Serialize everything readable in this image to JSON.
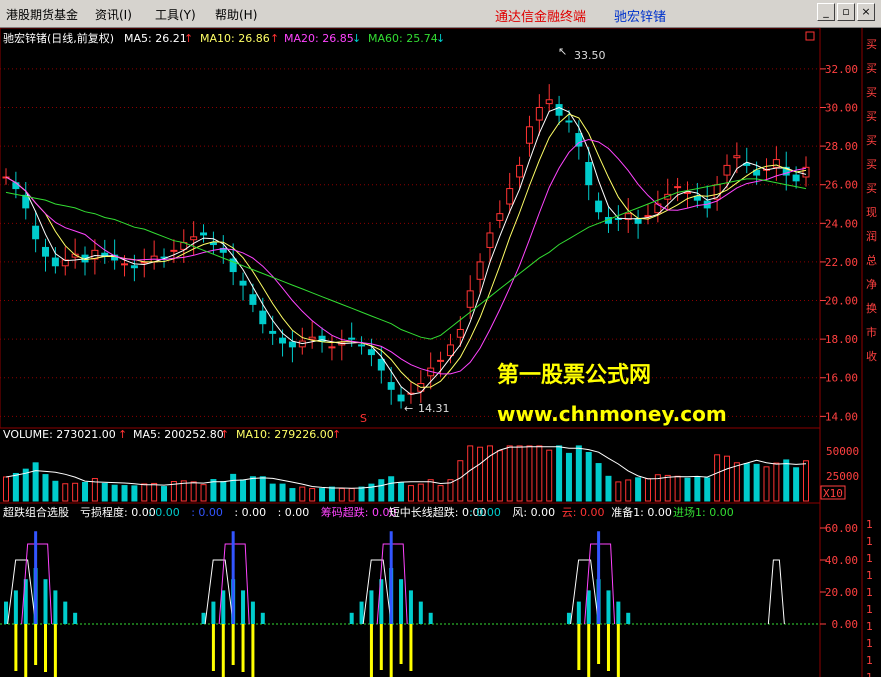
{
  "menubar": {
    "items": [
      "港股期货基金",
      "资讯(I)",
      "工具(Y)",
      "帮助(H)"
    ],
    "brand": "通达信金融终端",
    "stock_name": "驰宏锌锗",
    "window_buttons": [
      "minimize-icon",
      "restore-icon",
      "close-icon"
    ]
  },
  "colors": {
    "background": "#000000",
    "up": "#ff3333",
    "down": "#00cccc",
    "ma5": "#ffffff",
    "ma10": "#ffff66",
    "ma20": "#ff44ff",
    "ma60": "#33dd33",
    "grid": "#8b0000",
    "axis_text": "#ff4040",
    "watermark": "#ffff00"
  },
  "price_panel": {
    "title": "驰宏锌锗(日线,前复权)",
    "ma": [
      {
        "label": "MA5: 26.21",
        "arrow": "↑"
      },
      {
        "label": "MA10: 26.86",
        "arrow": "↑"
      },
      {
        "label": "MA20: 26.85",
        "arrow": "↓"
      },
      {
        "label": "MA60: 25.74",
        "arrow": "↓"
      }
    ],
    "y_ticks": [
      "32.00",
      "30.00",
      "28.00",
      "26.00",
      "24.00",
      "22.00",
      "20.00",
      "18.00",
      "16.00",
      "14.00"
    ],
    "high_marker": "33.50",
    "low_marker": "14.31",
    "s_marker": "S",
    "watermark_name": "第一股票公式网",
    "watermark_url": "www.chnmoney.com",
    "side_text": [
      "买",
      "买",
      "买",
      "买",
      "买",
      "买",
      "买",
      "现",
      "润",
      "总",
      "净",
      "换",
      "市",
      "收"
    ]
  },
  "volume_panel": {
    "label": "VOLUME: 273021.00",
    "arrow": "↑",
    "ma": [
      {
        "label": "MA5: 200252.80",
        "arrow": "↑"
      },
      {
        "label": "MA10: 279226.00",
        "arrow": "↑"
      }
    ],
    "y_ticks": [
      "50000",
      "25000"
    ],
    "unit": "X10",
    "side_text": [
      "1",
      "1",
      "1",
      "1"
    ]
  },
  "indicator_panel": {
    "name": "超跌组合选股",
    "items": [
      {
        "label": "亏损程度: 0.00",
        "color": "#ffffff"
      },
      {
        "label": ": 0.00",
        "color": "#00cccc"
      },
      {
        "label": ": 0.00",
        "color": "#3355ff"
      },
      {
        "label": ": 0.00",
        "color": "#ffffff"
      },
      {
        "label": ": 0.00",
        "color": "#ffffff"
      },
      {
        "label": "筹码超跌: 0.00",
        "color": "#ff44ff"
      },
      {
        "label": "短中长线超跌: 0.00",
        "color": "#ffffff"
      },
      {
        "label": ": 0.00",
        "color": "#00cccc"
      },
      {
        "label": "风: 0.00",
        "color": "#ffffff"
      },
      {
        "label": "云: 0.00",
        "color": "#ff3333"
      },
      {
        "label": "准备1: 0.00",
        "color": "#ffffff"
      },
      {
        "label": "进场1: 0.00",
        "color": "#33dd33"
      }
    ],
    "y_ticks": [
      "60.00",
      "40.00",
      "20.00",
      "0.00"
    ],
    "side_text": [
      "1",
      "1",
      "1",
      "1",
      "1",
      "1",
      "1",
      "1",
      "1",
      "1"
    ]
  },
  "chart_data": {
    "type": "candlestick",
    "y_range": [
      13.5,
      33.6
    ],
    "close": [
      26.4,
      25.8,
      24.8,
      23.2,
      22.3,
      21.8,
      22.1,
      22.4,
      22.0,
      22.6,
      22.3,
      22.1,
      21.9,
      21.7,
      22.0,
      22.3,
      22.2,
      22.6,
      23.0,
      23.3,
      23.4,
      22.9,
      22.5,
      21.5,
      20.8,
      19.8,
      18.8,
      18.3,
      17.8,
      17.6,
      17.9,
      18.1,
      17.9,
      17.6,
      17.8,
      18.0,
      17.7,
      17.2,
      16.4,
      15.4,
      14.8,
      15.2,
      15.7,
      16.5,
      16.9,
      17.7,
      18.5,
      20.5,
      22.0,
      23.5,
      24.5,
      25.8,
      27.0,
      29.0,
      30.0,
      30.4,
      29.6,
      29.3,
      28.0,
      26.0,
      24.6,
      24.0,
      24.2,
      24.5,
      24.0,
      24.4,
      25.0,
      25.5,
      25.9,
      25.6,
      25.2,
      24.8,
      26.0,
      27.0,
      27.5,
      27.0,
      26.5,
      26.8,
      27.3,
      26.5,
      26.2,
      26.9
    ],
    "ma60": [
      25.6,
      25.5,
      25.4,
      25.3,
      25.2,
      25.0,
      24.9,
      24.8,
      24.6,
      24.5,
      24.3,
      24.2,
      24.0,
      23.8,
      23.7,
      23.5,
      23.3,
      23.1,
      23.0,
      22.8,
      22.6,
      22.4,
      22.2,
      22.0,
      21.8,
      21.6,
      21.4,
      21.2,
      21.0,
      20.8,
      20.6,
      20.4,
      20.2,
      20.0,
      19.8,
      19.6,
      19.4,
      19.2,
      19.0,
      18.8,
      18.5,
      18.3,
      18.1,
      18.0,
      18.2,
      18.6,
      19.0,
      19.4,
      19.8,
      20.2,
      20.6,
      21.0,
      21.4,
      21.8,
      22.2,
      22.5,
      22.9,
      23.2,
      23.5,
      23.8,
      24.0,
      24.2,
      24.4,
      24.6,
      24.8,
      25.0,
      25.2,
      25.4,
      25.6,
      25.7,
      25.8,
      25.9,
      26.0,
      26.1,
      26.2,
      26.3,
      26.3,
      26.2,
      26.1,
      26.0,
      25.9,
      25.8
    ],
    "volume_max": 55000
  }
}
